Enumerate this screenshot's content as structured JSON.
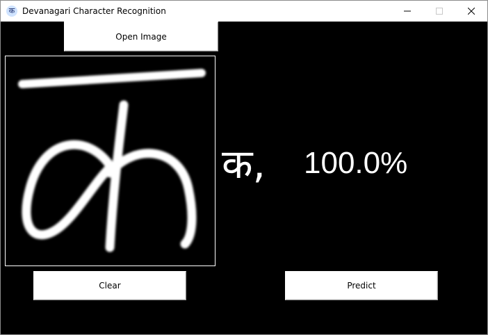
{
  "window": {
    "title": "Devanagari Character Recognition",
    "icon": "devanagari-ka-app-icon",
    "icon_glyph": "क",
    "controls": {
      "minimize": "—",
      "maximize": "☐",
      "close": "✕"
    }
  },
  "toolbar": {
    "open_label": "Open Image"
  },
  "canvas": {
    "content": "handwritten Devanagari ka character image",
    "background": "#000000",
    "stroke_color": "#ffffff"
  },
  "prediction": {
    "character": "क,",
    "confidence": "100.0%"
  },
  "actions": {
    "clear_label": "Clear",
    "predict_label": "Predict"
  }
}
